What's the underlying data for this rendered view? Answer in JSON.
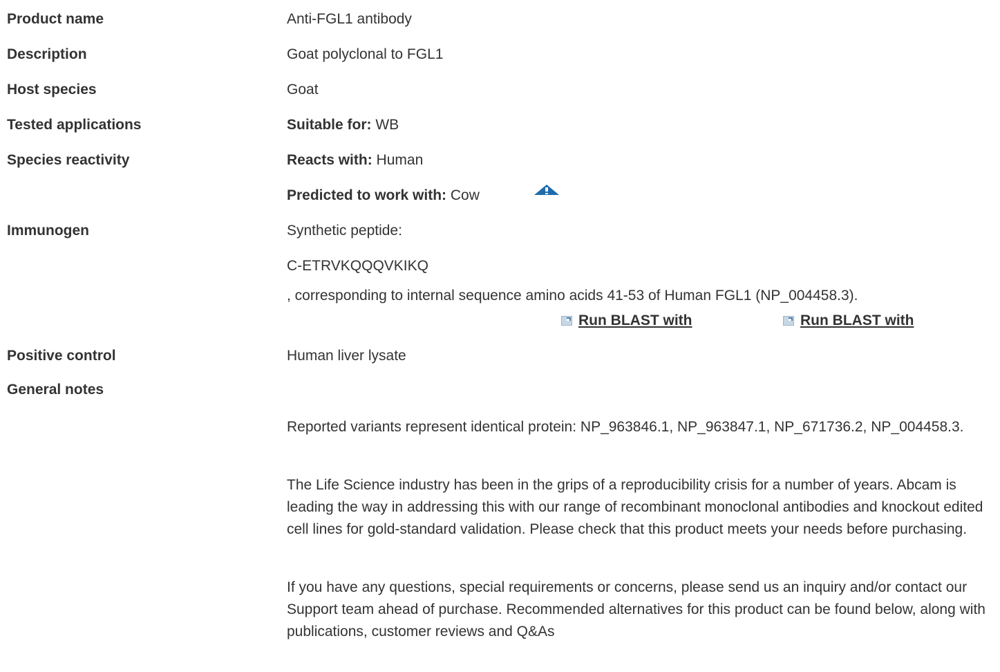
{
  "rows": {
    "product_name": {
      "label": "Product name",
      "value": "Anti-FGL1 antibody"
    },
    "description": {
      "label": "Description",
      "value": "Goat polyclonal to FGL1"
    },
    "host_species": {
      "label": "Host species",
      "value": "Goat"
    },
    "tested_applications": {
      "label": "Tested applications",
      "prefix": "Suitable for:",
      "value": "WB"
    },
    "species_reactivity": {
      "label": "Species reactivity",
      "reacts_prefix": "Reacts with:",
      "reacts_value": "Human",
      "predicted_prefix": "Predicted to work with:",
      "predicted_value": "Cow",
      "predicted_icon": "warning-triangle-icon"
    },
    "immunogen": {
      "label": "Immunogen",
      "line1": "Synthetic peptide:",
      "line2": "C-ETRVKQQQVKIKQ",
      "line3": ", corresponding to internal sequence amino acids 41-53 of Human FGL1 (NP_004458.3).",
      "blast_link_1": "Run BLAST with",
      "blast_link_2": "Run BLAST with",
      "blast_icon": "external-link-icon"
    },
    "positive_control": {
      "label": "Positive control",
      "value": "Human liver lysate"
    },
    "general_notes": {
      "label": "General notes",
      "para1": "Reported variants represent identical protein: NP_963846.1, NP_963847.1, NP_671736.2, NP_004458.3.",
      "para2": "The Life Science industry has been in the grips of a reproducibility crisis for a number of years. Abcam is leading the way in addressing this with our range of recombinant monoclonal antibodies and knockout edited cell lines for gold-standard validation. Please check that this product meets your needs before purchasing.",
      "para3": "If you have any questions, special requirements or concerns, please send us an inquiry and/or contact our Support team ahead of purchase. Recommended alternatives for this product can be found below, along with publications, customer reviews and Q&As"
    }
  },
  "colors": {
    "text": "#333333",
    "warning_icon": "#1f6bab"
  }
}
